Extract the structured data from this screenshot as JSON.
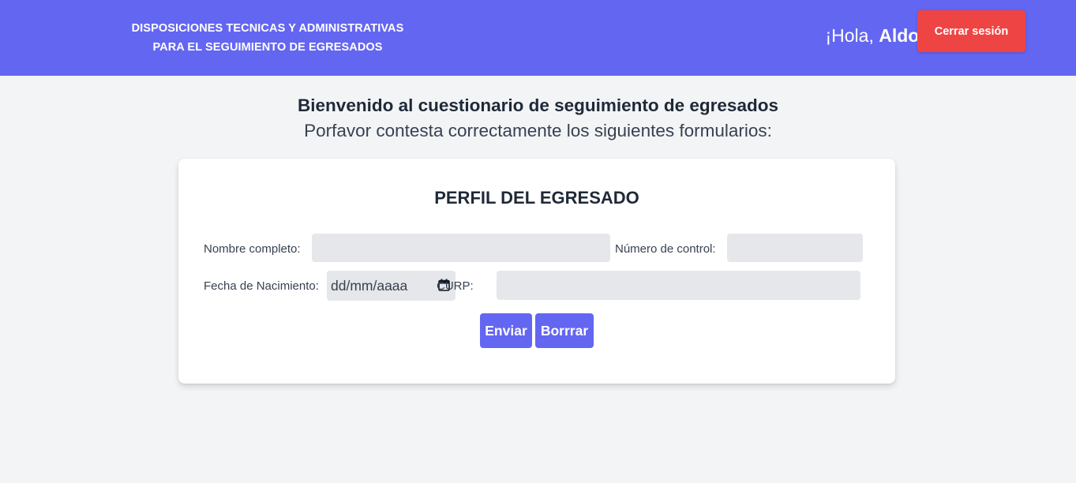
{
  "header": {
    "title_line1": "DISPOSICIONES TECNICAS Y ADMINISTRATIVAS",
    "title_line2": "PARA EL SEGUIMIENTO DE EGRESADOS",
    "greeting_prefix": "¡Hola, ",
    "user_name": "Aldo!",
    "logout_label": "Cerrar sesión"
  },
  "welcome": {
    "title": "Bienvenido al cuestionario de seguimiento de egresados",
    "subtitle": "Porfavor contesta correctamente los siguientes formularios:"
  },
  "form": {
    "title": "PERFIL DEL EGRESADO",
    "nombre_label": "Nombre completo:",
    "nombre_value": "",
    "control_label": "Número de control:",
    "control_value": "",
    "fecha_label": "Fecha de Nacimiento:",
    "fecha_placeholder": "dd/mm/aaaa",
    "curp_label": "CURP:",
    "curp_value": "",
    "submit_label": "Enviar",
    "reset_label": "Borrrar"
  },
  "colors": {
    "header_bg": "#6366f1",
    "logout_bg": "#ef4444",
    "page_bg": "#f3f4f6",
    "input_bg": "#e5e7eb",
    "button_bg": "#6366f1"
  },
  "icons": {
    "date_picker": "calendar-icon"
  }
}
